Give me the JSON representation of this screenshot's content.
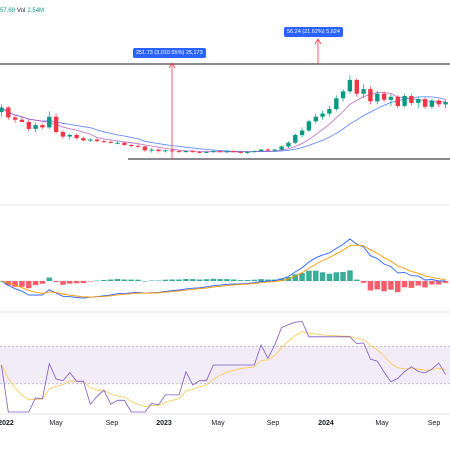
{
  "header": {
    "price_fragment": "57.69",
    "volume_label": "Vol",
    "volume_value": "2.54M"
  },
  "annotations": {
    "measure_left": "251.73 (3,010.55%) 25,173",
    "measure_right": "56.24 (21.62%) 5,624"
  },
  "colors": {
    "up": "#089981",
    "down": "#f23645",
    "macd_line": "#2962ff",
    "signal_line": "#ff9800",
    "rsi_line": "#7e57c2",
    "rsi_band": "#ede7f6",
    "tag_bg": "#2962ff",
    "measure_line": "#f23645"
  },
  "chart_data": [
    {
      "type": "candlestick",
      "title": "",
      "x_labels": [
        "2022",
        "May",
        "Sep",
        "2023",
        "May",
        "Sep",
        "2024",
        "May",
        "Sep"
      ],
      "ohlc": [
        [
          110,
          120,
          104,
          116
        ],
        [
          116,
          118,
          100,
          103
        ],
        [
          103,
          106,
          96,
          100
        ],
        [
          100,
          104,
          97,
          97
        ],
        [
          97,
          101,
          85,
          88
        ],
        [
          88,
          96,
          84,
          93
        ],
        [
          93,
          95,
          88,
          90
        ],
        [
          90,
          111,
          88,
          104
        ],
        [
          104,
          108,
          82,
          84
        ],
        [
          84,
          86,
          75,
          78
        ],
        [
          78,
          82,
          74,
          80
        ],
        [
          80,
          82,
          74,
          76
        ],
        [
          76,
          78,
          72,
          73
        ],
        [
          73,
          76,
          71,
          74
        ],
        [
          74,
          76,
          71,
          72
        ],
        [
          72,
          74,
          70,
          71
        ],
        [
          71,
          73,
          69,
          70
        ],
        [
          70,
          72,
          68,
          70
        ],
        [
          70,
          71,
          66,
          67
        ],
        [
          67,
          69,
          64,
          66
        ],
        [
          66,
          68,
          63,
          65
        ],
        [
          65,
          66,
          58,
          60
        ],
        [
          60,
          63,
          57,
          61
        ],
        [
          61,
          62,
          57,
          59
        ],
        [
          59,
          61,
          57,
          60
        ],
        [
          60,
          61,
          58,
          59
        ],
        [
          59,
          60,
          57,
          58
        ],
        [
          58,
          60,
          57,
          59
        ],
        [
          59,
          60,
          57,
          58
        ],
        [
          58,
          59,
          56,
          57
        ],
        [
          57,
          59,
          56,
          58
        ],
        [
          58,
          60,
          57,
          59
        ],
        [
          59,
          60,
          57,
          58
        ],
        [
          58,
          60,
          56,
          59
        ],
        [
          59,
          60,
          57,
          58
        ],
        [
          58,
          59,
          56,
          57
        ],
        [
          57,
          59,
          55,
          58
        ],
        [
          58,
          60,
          57,
          59
        ],
        [
          59,
          62,
          58,
          61
        ],
        [
          61,
          63,
          59,
          60
        ],
        [
          60,
          62,
          58,
          61
        ],
        [
          61,
          66,
          60,
          65
        ],
        [
          65,
          72,
          63,
          70
        ],
        [
          70,
          82,
          68,
          80
        ],
        [
          80,
          90,
          77,
          86
        ],
        [
          86,
          100,
          84,
          98
        ],
        [
          98,
          108,
          95,
          104
        ],
        [
          104,
          112,
          100,
          108
        ],
        [
          108,
          118,
          104,
          114
        ],
        [
          114,
          132,
          111,
          128
        ],
        [
          128,
          140,
          124,
          137
        ],
        [
          137,
          158,
          134,
          152
        ],
        [
          152,
          154,
          130,
          134
        ],
        [
          134,
          146,
          128,
          140
        ],
        [
          140,
          144,
          120,
          124
        ],
        [
          124,
          138,
          120,
          134
        ],
        [
          134,
          137,
          123,
          126
        ],
        [
          126,
          134,
          118,
          130
        ],
        [
          130,
          132,
          115,
          118
        ],
        [
          118,
          134,
          116,
          131
        ],
        [
          131,
          134,
          119,
          122
        ],
        [
          122,
          130,
          115,
          127
        ],
        [
          127,
          129,
          114,
          117
        ],
        [
          117,
          128,
          114,
          125
        ],
        [
          125,
          127,
          116,
          120
        ],
        [
          120,
          126,
          115,
          123
        ]
      ],
      "moving_averages": [
        {
          "name": "MA1",
          "color": "#ab47bc"
        },
        {
          "name": "MA2",
          "color": "#2962ff"
        }
      ]
    },
    {
      "type": "macd",
      "lines": [
        "MACD",
        "Signal"
      ]
    },
    {
      "type": "rsi",
      "band": [
        30,
        70
      ]
    }
  ]
}
